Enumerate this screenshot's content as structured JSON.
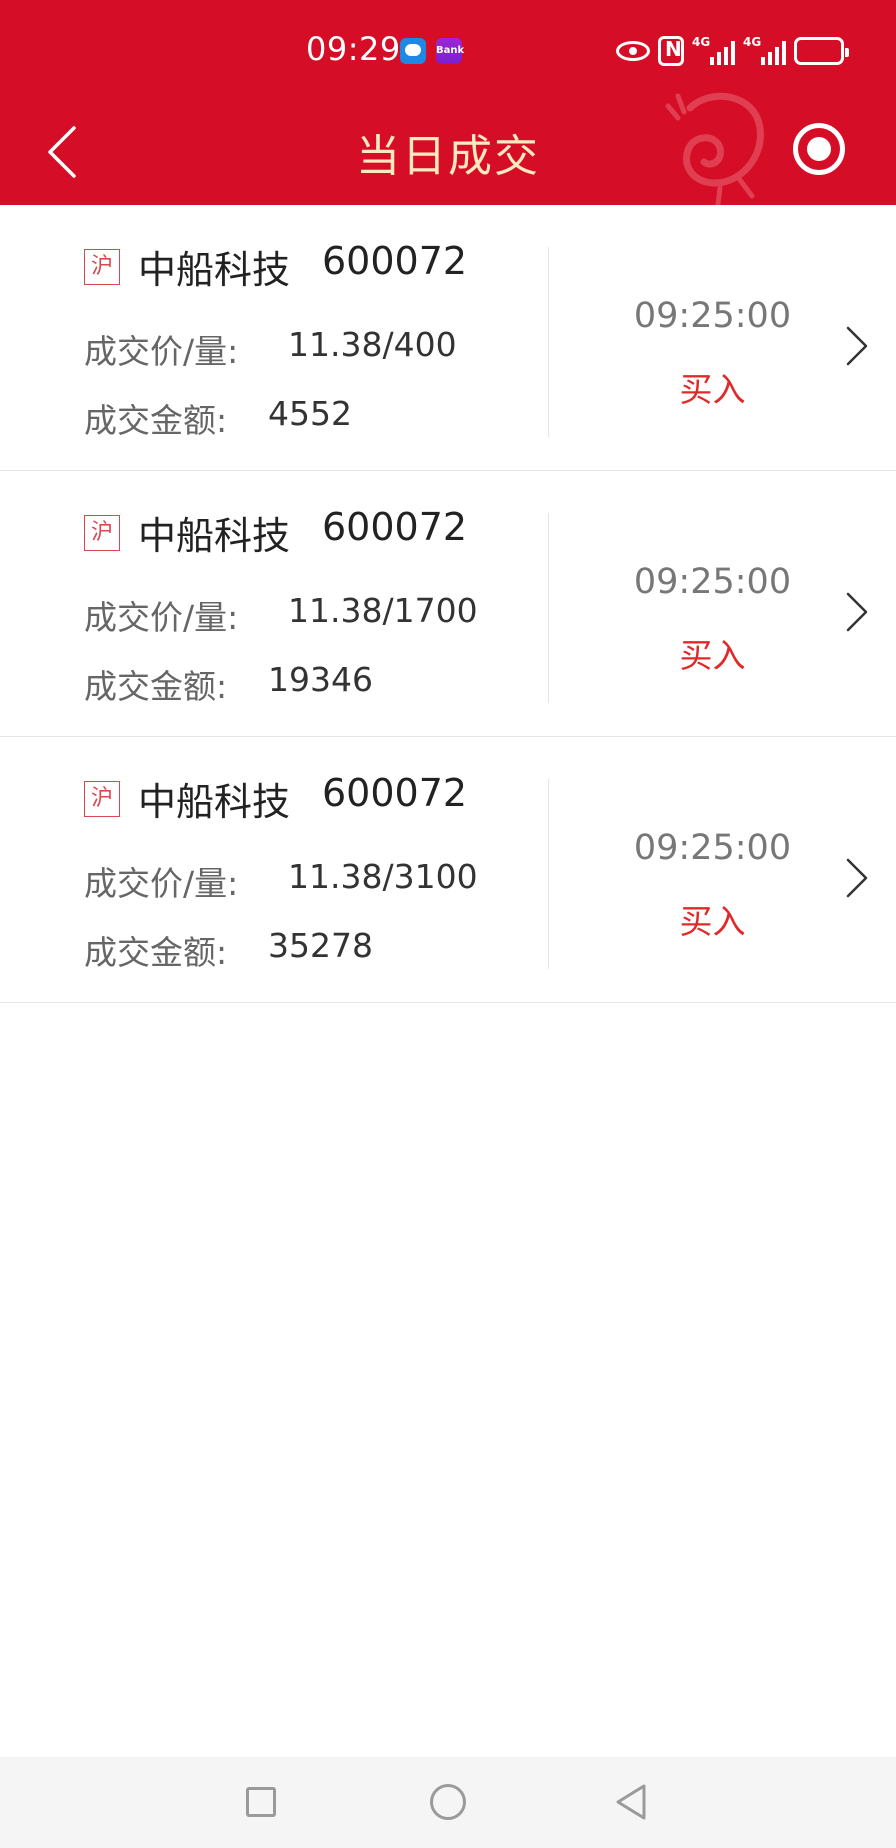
{
  "status_bar": {
    "time": "09:29",
    "bank_badge": "Bank",
    "network_1": "4G",
    "network_2": "4G"
  },
  "header": {
    "title": "当日成交",
    "icons": [
      "back-icon",
      "dragon-watermark",
      "target-icon"
    ]
  },
  "colors": {
    "header_bg": "#d60d26",
    "title": "#fde9c0",
    "buy": "#e02a2a",
    "badge": "#d9484f"
  },
  "labels": {
    "price": "成交价/量:",
    "amount": "成交金额:"
  },
  "trades": [
    {
      "market": "沪",
      "name": "中船科技",
      "code": "600072",
      "price_qty": "11.38/400",
      "amount": "4552",
      "time": "09:25:00",
      "side": "买入"
    },
    {
      "market": "沪",
      "name": "中船科技",
      "code": "600072",
      "price_qty": "11.38/1700",
      "amount": "19346",
      "time": "09:25:00",
      "side": "买入"
    },
    {
      "market": "沪",
      "name": "中船科技",
      "code": "600072",
      "price_qty": "11.38/3100",
      "amount": "35278",
      "time": "09:25:00",
      "side": "买入"
    }
  ],
  "system_nav": [
    "recents-icon",
    "home-icon",
    "back-icon"
  ]
}
